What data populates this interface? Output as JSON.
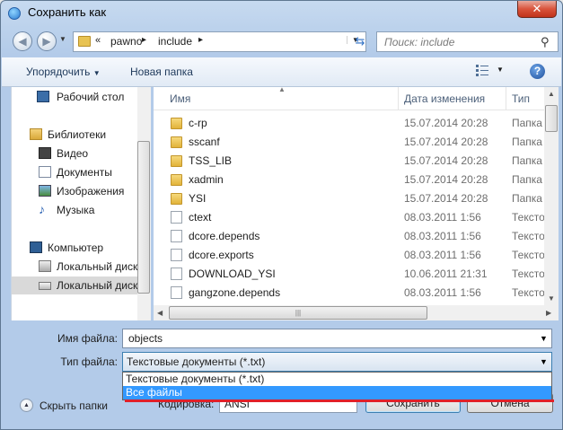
{
  "window": {
    "title": "Сохранить как",
    "close_glyph": "✕"
  },
  "address": {
    "overflow_glyph": "«",
    "path": [
      "pawno",
      "include"
    ],
    "separator": "▸",
    "refresh_glyph": "⇆"
  },
  "search": {
    "placeholder": "Поиск: include",
    "icon": "magnifier-icon"
  },
  "toolbar": {
    "organize_label": "Упорядочить",
    "new_folder_label": "Новая папка",
    "help_glyph": "?"
  },
  "sidebar": {
    "items": [
      {
        "label": "Рабочий стол",
        "icon": "desktop-icon"
      },
      {
        "label": "Библиотеки",
        "icon": "libraries-icon"
      },
      {
        "label": "Видео",
        "icon": "video-icon"
      },
      {
        "label": "Документы",
        "icon": "documents-icon"
      },
      {
        "label": "Изображения",
        "icon": "pictures-icon"
      },
      {
        "label": "Музыка",
        "icon": "music-icon"
      },
      {
        "label": "Компьютер",
        "icon": "computer-icon"
      },
      {
        "label": "Локальный диск",
        "icon": "system-drive-icon"
      },
      {
        "label": "Локальный диск",
        "icon": "drive-icon",
        "selected": true
      }
    ]
  },
  "filelist": {
    "columns": {
      "name": "Имя",
      "date": "Дата изменения",
      "type": "Тип"
    },
    "rows": [
      {
        "name": "c-rp",
        "date": "15.07.2014 20:28",
        "type": "Папка",
        "kind": "folder"
      },
      {
        "name": "sscanf",
        "date": "15.07.2014 20:28",
        "type": "Папка",
        "kind": "folder"
      },
      {
        "name": "TSS_LIB",
        "date": "15.07.2014 20:28",
        "type": "Папка",
        "kind": "folder"
      },
      {
        "name": "xadmin",
        "date": "15.07.2014 20:28",
        "type": "Папка",
        "kind": "folder"
      },
      {
        "name": "YSI",
        "date": "15.07.2014 20:28",
        "type": "Папка",
        "kind": "folder"
      },
      {
        "name": "ctext",
        "date": "08.03.2011 1:56",
        "type": "Тексто",
        "kind": "file"
      },
      {
        "name": "dcore.depends",
        "date": "08.03.2011 1:56",
        "type": "Тексто",
        "kind": "file"
      },
      {
        "name": "dcore.exports",
        "date": "08.03.2011 1:56",
        "type": "Тексто",
        "kind": "file"
      },
      {
        "name": "DOWNLOAD_YSI",
        "date": "10.06.2011 21:31",
        "type": "Тексто",
        "kind": "file"
      },
      {
        "name": "gangzone.depends",
        "date": "08.03.2011 1:56",
        "type": "Тексто",
        "kind": "file"
      }
    ]
  },
  "form": {
    "filename_label": "Имя файла:",
    "filename_value": "objects",
    "filetype_label": "Тип файла:",
    "filetype_value": "Текстовые документы (*.txt)",
    "filetype_options": [
      "Текстовые документы (*.txt)",
      "Все файлы"
    ],
    "highlighted_option": 1,
    "encoding_label": "Кодировка:",
    "encoding_value": "ANSI"
  },
  "footer": {
    "hide_folders_label": "Скрыть папки",
    "save_label": "Сохранить",
    "cancel_label": "Отмена"
  },
  "colors": {
    "highlight": "#3399ff",
    "annotation_red": "#e0202a",
    "frame": "#b9cfea"
  }
}
